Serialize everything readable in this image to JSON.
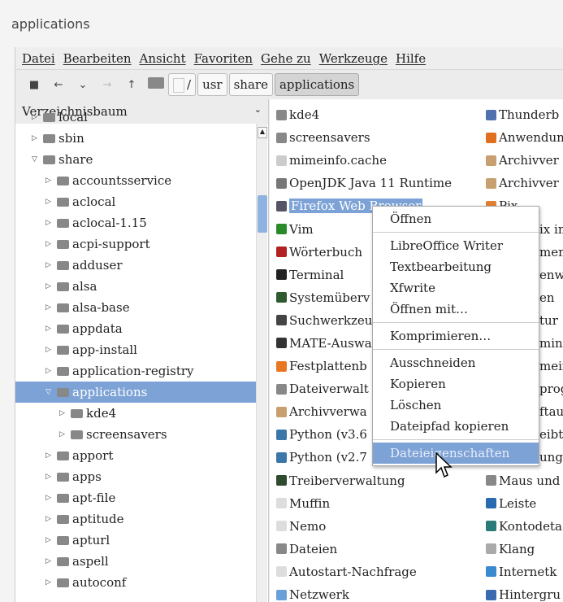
{
  "window": {
    "title": "applications"
  },
  "menubar": [
    {
      "label": "Datei"
    },
    {
      "label": "Bearbeiten"
    },
    {
      "label": "Ansicht"
    },
    {
      "label": "Favoriten"
    },
    {
      "label": "Gehe zu"
    },
    {
      "label": "Werkzeuge"
    },
    {
      "label": "Hilfe"
    }
  ],
  "toolbar": {
    "breadcrumbs": [
      "/",
      "usr",
      "share",
      "applications"
    ],
    "active": "applications"
  },
  "sidebar": {
    "title": "Verzeichnisbaum",
    "items": [
      {
        "label": "local",
        "level": 1,
        "expanded": false
      },
      {
        "label": "sbin",
        "level": 1,
        "expanded": false
      },
      {
        "label": "share",
        "level": 1,
        "expanded": true
      },
      {
        "label": "accountsservice",
        "level": 2
      },
      {
        "label": "aclocal",
        "level": 2
      },
      {
        "label": "aclocal-1.15",
        "level": 2
      },
      {
        "label": "acpi-support",
        "level": 2
      },
      {
        "label": "adduser",
        "level": 2
      },
      {
        "label": "alsa",
        "level": 2
      },
      {
        "label": "alsa-base",
        "level": 2
      },
      {
        "label": "appdata",
        "level": 2
      },
      {
        "label": "app-install",
        "level": 2
      },
      {
        "label": "application-registry",
        "level": 2
      },
      {
        "label": "applications",
        "level": 2,
        "expanded": true,
        "selected": true
      },
      {
        "label": "kde4",
        "level": 3
      },
      {
        "label": "screensavers",
        "level": 3
      },
      {
        "label": "apport",
        "level": 2
      },
      {
        "label": "apps",
        "level": 2
      },
      {
        "label": "apt-file",
        "level": 2
      },
      {
        "label": "aptitude",
        "level": 2
      },
      {
        "label": "apturl",
        "level": 2
      },
      {
        "label": "aspell",
        "level": 2
      },
      {
        "label": "autoconf",
        "level": 2
      }
    ]
  },
  "files": {
    "col1": [
      {
        "label": "kde4",
        "icon": "folder",
        "color": "#888888"
      },
      {
        "label": "screensavers",
        "icon": "folder",
        "color": "#888888"
      },
      {
        "label": "mimeinfo.cache",
        "icon": "file",
        "color": "#cccccc"
      },
      {
        "label": "OpenJDK Java 11 Runtime",
        "icon": "java",
        "color": "#777777"
      },
      {
        "label": "Firefox Web Browser",
        "icon": "firefox",
        "color": "#555566",
        "selected": true
      },
      {
        "label": "Vim",
        "icon": "vim",
        "color": "#2a8a2a"
      },
      {
        "label": "Wörterbuch",
        "icon": "dictionary",
        "color": "#b22222"
      },
      {
        "label": "Terminal",
        "icon": "terminal",
        "color": "#222222"
      },
      {
        "label": "Systemüberv",
        "icon": "monitor",
        "color": "#2f5a2f"
      },
      {
        "label": "Suchwerkzeu",
        "icon": "search",
        "color": "#444444"
      },
      {
        "label": "MATE-Auswa",
        "icon": "drop",
        "color": "#333333"
      },
      {
        "label": "Festplattenb",
        "icon": "disk",
        "color": "#e87722"
      },
      {
        "label": "Dateiverwalt",
        "icon": "folder",
        "color": "#888888"
      },
      {
        "label": "Archivverwa",
        "icon": "archive",
        "color": "#c8a070"
      },
      {
        "label": "Python (v3.6",
        "icon": "python",
        "color": "#3b77a8"
      },
      {
        "label": "Python (v2.7",
        "icon": "python",
        "color": "#3b77a8"
      },
      {
        "label": "Treiberverwaltung",
        "icon": "chip",
        "color": "#2f4a2f"
      },
      {
        "label": "Muffin",
        "icon": "app",
        "color": "#dddddd"
      },
      {
        "label": "Nemo",
        "icon": "app",
        "color": "#dddddd"
      },
      {
        "label": "Dateien",
        "icon": "folder",
        "color": "#888888"
      },
      {
        "label": "Autostart-Nachfrage",
        "icon": "app",
        "color": "#dddddd"
      },
      {
        "label": "Netzwerk",
        "icon": "wifi",
        "color": "#6aa0d8"
      }
    ],
    "col2": [
      {
        "label": "Thunderb",
        "icon": "mail",
        "color": "#5070b0"
      },
      {
        "label": "Anwendun",
        "icon": "software",
        "color": "#e07020"
      },
      {
        "label": "Archivver",
        "icon": "archive",
        "color": "#c8a070"
      },
      {
        "label": "Archivver",
        "icon": "archive",
        "color": "#c8a070"
      },
      {
        "label": "Pix",
        "icon": "image",
        "color": "#e08030"
      },
      {
        "label": "ix im"
      },
      {
        "label": "ment"
      },
      {
        "label": "enwi"
      },
      {
        "label": "en"
      },
      {
        "label": "tur"
      },
      {
        "label": "minf"
      },
      {
        "label": "mein"
      },
      {
        "label": "prog"
      },
      {
        "label": "ftaus"
      },
      {
        "label": "eibtis"
      },
      {
        "label": "unge"
      },
      {
        "label": "Maus und",
        "icon": "mouse",
        "color": "#888888"
      },
      {
        "label": "Leiste",
        "icon": "panel",
        "color": "#2a6ab0"
      },
      {
        "label": "Kontodeta",
        "icon": "user",
        "color": "#2a7a7a"
      },
      {
        "label": "Klang",
        "icon": "sound",
        "color": "#aaaaaa"
      },
      {
        "label": "Internetk",
        "icon": "cloud",
        "color": "#3a8ad0"
      },
      {
        "label": "Hintergru",
        "icon": "wallpaper",
        "color": "#3a6ab0"
      }
    ]
  },
  "context_menu": {
    "items": [
      "Öffnen",
      "LibreOffice Writer",
      "Textbearbeitung",
      "Xfwrite",
      "Öffnen mit…",
      "Komprimieren…",
      "Ausschneiden",
      "Kopieren",
      "Löschen",
      "Dateipfad kopieren",
      "Dateieigenschaften"
    ],
    "highlighted": "Dateieigenschaften"
  },
  "colors": {
    "selection": "#7da2d6"
  }
}
